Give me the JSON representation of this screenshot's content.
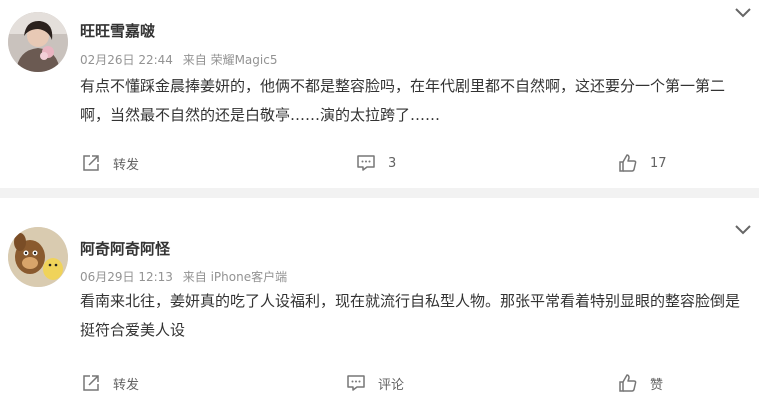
{
  "comments": [
    {
      "username": "旺旺雪嘉啵",
      "date": "02月26日 22:44",
      "source": "来自 荣耀Magic5",
      "text": "有点不懂踩金晨捧姜妍的，他俩不都是整容脸吗，在年代剧里都不自然啊，这还要分一个第一第二啊，当然最不自然的还是白敬亭……演的太拉跨了……",
      "forward_label": "转发",
      "comment_label": "3",
      "like_label": "17"
    },
    {
      "username": "阿奇阿奇阿怪",
      "date": "06月29日 12:13",
      "source": "来自 iPhone客户端",
      "text": "看南来北往，姜妍真的吃了人设福利，现在就流行自私型人物。那张平常看着特别显眼的整容脸倒是挺符合爱美人设",
      "forward_label": "转发",
      "comment_label": "评论",
      "like_label": "赞"
    }
  ],
  "icons": {
    "forward": "forward-icon",
    "comment": "comment-icon",
    "like": "thumbs-up-icon",
    "menu": "chevron-down-icon"
  }
}
